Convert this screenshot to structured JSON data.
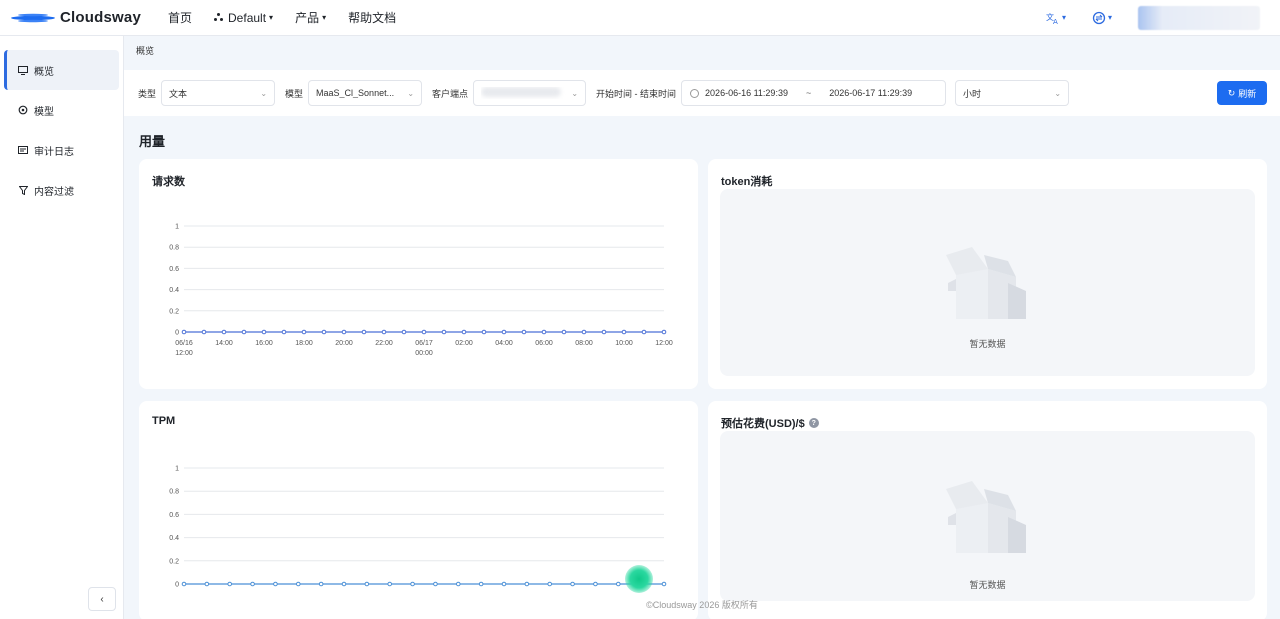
{
  "brand": {
    "name": "Cloudsway",
    "accent": "#1d6cf0"
  },
  "nav": {
    "home": "首页",
    "workspace": "Default",
    "products": "产品",
    "docs": "帮助文档"
  },
  "top_right": {
    "translate_icon": "translate-icon",
    "switch_icon": "switch-icon"
  },
  "sidebar": {
    "items": [
      {
        "label": "概览",
        "icon": "monitor-icon"
      },
      {
        "label": "模型",
        "icon": "model-icon"
      },
      {
        "label": "审计日志",
        "icon": "log-icon"
      },
      {
        "label": "内容过滤",
        "icon": "filter-icon"
      }
    ],
    "collapse": "‹"
  },
  "breadcrumb": "概览",
  "filters": {
    "type_label": "类型",
    "type_value": "文本",
    "model_label": "模型",
    "model_value": "MaaS_Cl_Sonnet...",
    "endpoint_label": "客户端点",
    "time_label": "开始时间 - 结束时间",
    "start": "2026-06-16 11:29:39",
    "range_sep": "~",
    "end": "2026-06-17 11:29:39",
    "granularity": "小时",
    "refresh": "刷新"
  },
  "section_title": "用量",
  "cards": {
    "requests": {
      "title": "请求数"
    },
    "tokens": {
      "title": "token消耗",
      "empty": "暂无数据"
    },
    "tpm": {
      "title": "TPM"
    },
    "cost": {
      "title": "预估花费(USD)/$",
      "empty": "暂无数据"
    }
  },
  "footer": "©Cloudsway 2026 版权所有",
  "chart_data": [
    {
      "type": "line",
      "title": "请求数",
      "y_ticks": [
        "1",
        "0.8",
        "0.6",
        "0.4",
        "0.2",
        "0"
      ],
      "ylim": [
        0,
        1
      ],
      "x_labels": [
        "06/16\n12:00",
        "14:00",
        "16:00",
        "18:00",
        "20:00",
        "22:00",
        "06/17\n00:00",
        "02:00",
        "04:00",
        "06:00",
        "08:00",
        "10:00",
        "12:00"
      ],
      "series": [
        {
          "values": [
            0,
            0,
            0,
            0,
            0,
            0,
            0,
            0,
            0,
            0,
            0,
            0,
            0,
            0,
            0,
            0,
            0,
            0,
            0,
            0,
            0,
            0,
            0,
            0,
            0
          ]
        }
      ],
      "grid": true,
      "color": "#4a6fd6"
    },
    {
      "type": "line",
      "title": "TPM",
      "y_ticks": [
        "1",
        "0.8",
        "0.6",
        "0.4",
        "0.2",
        "0"
      ],
      "ylim": [
        0,
        1
      ],
      "series": [
        {
          "values": [
            0,
            0,
            0,
            0,
            0,
            0,
            0,
            0,
            0,
            0,
            0,
            0,
            0,
            0,
            0,
            0,
            0,
            0,
            0,
            0,
            0,
            0
          ]
        }
      ],
      "grid": true,
      "color": "#4a8fd6"
    }
  ]
}
